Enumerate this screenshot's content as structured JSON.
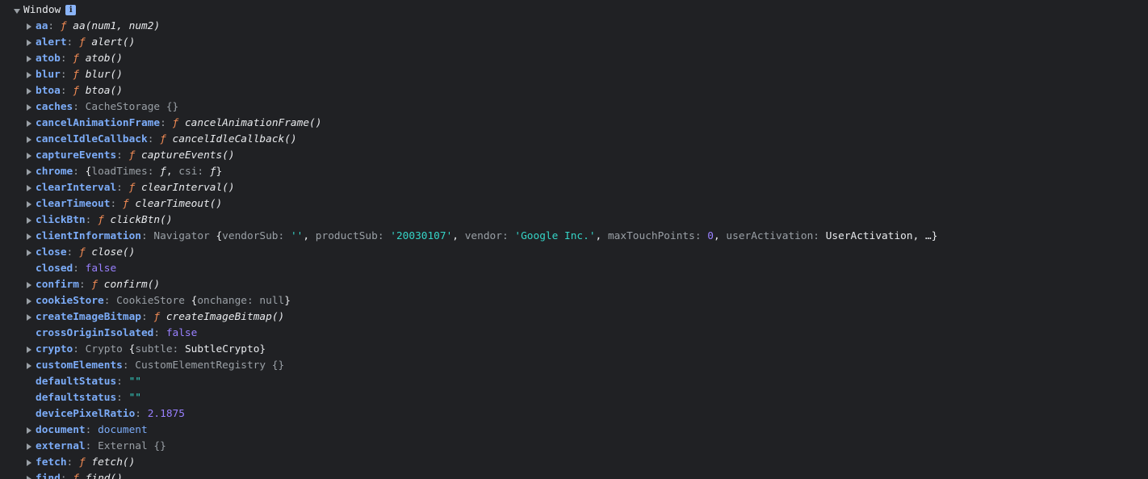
{
  "header": {
    "title": "Window",
    "info": "i"
  },
  "props": {
    "aa": {
      "key": "aa",
      "sig": "aa(num1, num2)"
    },
    "alert": {
      "key": "alert",
      "sig": "alert()"
    },
    "atob": {
      "key": "atob",
      "sig": "atob()"
    },
    "blur": {
      "key": "blur",
      "sig": "blur()"
    },
    "btoa": {
      "key": "btoa",
      "sig": "btoa()"
    },
    "caches": {
      "key": "caches",
      "value": "CacheStorage {}"
    },
    "cancelAnimationFrame": {
      "key": "cancelAnimationFrame",
      "sig": "cancelAnimationFrame()"
    },
    "cancelIdleCallback": {
      "key": "cancelIdleCallback",
      "sig": "cancelIdleCallback()"
    },
    "captureEvents": {
      "key": "captureEvents",
      "sig": "captureEvents()"
    },
    "chrome": {
      "key": "chrome",
      "k1": "loadTimes",
      "v1": "ƒ",
      "k2": "csi",
      "v2": "ƒ"
    },
    "clearInterval": {
      "key": "clearInterval",
      "sig": "clearInterval()"
    },
    "clearTimeout": {
      "key": "clearTimeout",
      "sig": "clearTimeout()"
    },
    "clickBtn": {
      "key": "clickBtn",
      "sig": "clickBtn()"
    },
    "clientInformation": {
      "key": "clientInformation",
      "cls": "Navigator",
      "k1": "vendorSub",
      "v1": "''",
      "k2": "productSub",
      "v2": "'20030107'",
      "k3": "vendor",
      "v3": "'Google Inc.'",
      "k4": "maxTouchPoints",
      "v4": "0",
      "k5": "userActivation",
      "v5": "UserActivation",
      "tail": ", …}"
    },
    "close": {
      "key": "close",
      "sig": "close()"
    },
    "closed": {
      "key": "closed",
      "value": "false"
    },
    "confirm": {
      "key": "confirm",
      "sig": "confirm()"
    },
    "cookieStore": {
      "key": "cookieStore",
      "cls": "CookieStore",
      "k1": "onchange",
      "v1": "null"
    },
    "createImageBitmap": {
      "key": "createImageBitmap",
      "sig": "createImageBitmap()"
    },
    "crossOriginIsolated": {
      "key": "crossOriginIsolated",
      "value": "false"
    },
    "crypto": {
      "key": "crypto",
      "cls": "Crypto",
      "k1": "subtle",
      "v1": "SubtleCrypto"
    },
    "customElements": {
      "key": "customElements",
      "value": "CustomElementRegistry {}"
    },
    "defaultStatus": {
      "key": "defaultStatus",
      "value": "\"\""
    },
    "defaultstatus": {
      "key": "defaultstatus",
      "value": "\"\""
    },
    "devicePixelRatio": {
      "key": "devicePixelRatio",
      "value": "2.1875"
    },
    "document": {
      "key": "document",
      "value": "document"
    },
    "external": {
      "key": "external",
      "value": "External {}"
    },
    "fetch": {
      "key": "fetch",
      "sig": "fetch()"
    },
    "find": {
      "key": "find",
      "sig": "find()"
    }
  },
  "fglyph": "ƒ",
  "colon": ": ",
  "comma": ", ",
  "lbrace": " {",
  "lbrace0": "{",
  "rbrace": "}",
  "colors": {
    "background": "#202124",
    "key": "#7cacf8",
    "function": "#f28b54",
    "string": "#35d4c7",
    "boolean": "#9980ff",
    "muted": "#9aa0a6"
  }
}
